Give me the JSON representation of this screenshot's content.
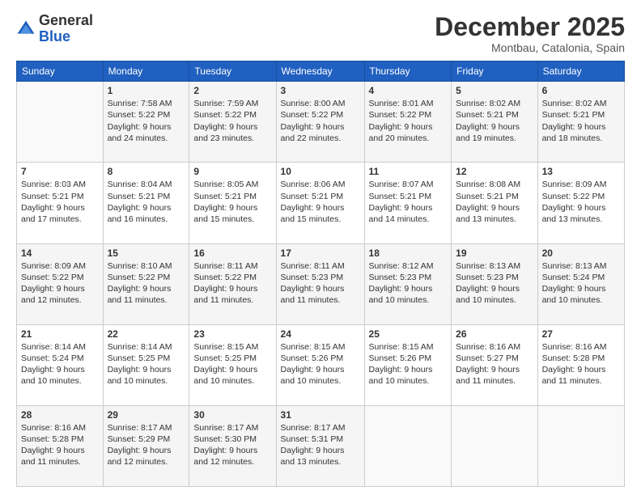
{
  "logo": {
    "general": "General",
    "blue": "Blue"
  },
  "header": {
    "month": "December 2025",
    "location": "Montbau, Catalonia, Spain"
  },
  "weekdays": [
    "Sunday",
    "Monday",
    "Tuesday",
    "Wednesday",
    "Thursday",
    "Friday",
    "Saturday"
  ],
  "weeks": [
    [
      {
        "day": "",
        "info": ""
      },
      {
        "day": "1",
        "info": "Sunrise: 7:58 AM\nSunset: 5:22 PM\nDaylight: 9 hours\nand 24 minutes."
      },
      {
        "day": "2",
        "info": "Sunrise: 7:59 AM\nSunset: 5:22 PM\nDaylight: 9 hours\nand 23 minutes."
      },
      {
        "day": "3",
        "info": "Sunrise: 8:00 AM\nSunset: 5:22 PM\nDaylight: 9 hours\nand 22 minutes."
      },
      {
        "day": "4",
        "info": "Sunrise: 8:01 AM\nSunset: 5:22 PM\nDaylight: 9 hours\nand 20 minutes."
      },
      {
        "day": "5",
        "info": "Sunrise: 8:02 AM\nSunset: 5:21 PM\nDaylight: 9 hours\nand 19 minutes."
      },
      {
        "day": "6",
        "info": "Sunrise: 8:02 AM\nSunset: 5:21 PM\nDaylight: 9 hours\nand 18 minutes."
      }
    ],
    [
      {
        "day": "7",
        "info": "Sunrise: 8:03 AM\nSunset: 5:21 PM\nDaylight: 9 hours\nand 17 minutes."
      },
      {
        "day": "8",
        "info": "Sunrise: 8:04 AM\nSunset: 5:21 PM\nDaylight: 9 hours\nand 16 minutes."
      },
      {
        "day": "9",
        "info": "Sunrise: 8:05 AM\nSunset: 5:21 PM\nDaylight: 9 hours\nand 15 minutes."
      },
      {
        "day": "10",
        "info": "Sunrise: 8:06 AM\nSunset: 5:21 PM\nDaylight: 9 hours\nand 15 minutes."
      },
      {
        "day": "11",
        "info": "Sunrise: 8:07 AM\nSunset: 5:21 PM\nDaylight: 9 hours\nand 14 minutes."
      },
      {
        "day": "12",
        "info": "Sunrise: 8:08 AM\nSunset: 5:21 PM\nDaylight: 9 hours\nand 13 minutes."
      },
      {
        "day": "13",
        "info": "Sunrise: 8:09 AM\nSunset: 5:22 PM\nDaylight: 9 hours\nand 13 minutes."
      }
    ],
    [
      {
        "day": "14",
        "info": "Sunrise: 8:09 AM\nSunset: 5:22 PM\nDaylight: 9 hours\nand 12 minutes."
      },
      {
        "day": "15",
        "info": "Sunrise: 8:10 AM\nSunset: 5:22 PM\nDaylight: 9 hours\nand 11 minutes."
      },
      {
        "day": "16",
        "info": "Sunrise: 8:11 AM\nSunset: 5:22 PM\nDaylight: 9 hours\nand 11 minutes."
      },
      {
        "day": "17",
        "info": "Sunrise: 8:11 AM\nSunset: 5:23 PM\nDaylight: 9 hours\nand 11 minutes."
      },
      {
        "day": "18",
        "info": "Sunrise: 8:12 AM\nSunset: 5:23 PM\nDaylight: 9 hours\nand 10 minutes."
      },
      {
        "day": "19",
        "info": "Sunrise: 8:13 AM\nSunset: 5:23 PM\nDaylight: 9 hours\nand 10 minutes."
      },
      {
        "day": "20",
        "info": "Sunrise: 8:13 AM\nSunset: 5:24 PM\nDaylight: 9 hours\nand 10 minutes."
      }
    ],
    [
      {
        "day": "21",
        "info": "Sunrise: 8:14 AM\nSunset: 5:24 PM\nDaylight: 9 hours\nand 10 minutes."
      },
      {
        "day": "22",
        "info": "Sunrise: 8:14 AM\nSunset: 5:25 PM\nDaylight: 9 hours\nand 10 minutes."
      },
      {
        "day": "23",
        "info": "Sunrise: 8:15 AM\nSunset: 5:25 PM\nDaylight: 9 hours\nand 10 minutes."
      },
      {
        "day": "24",
        "info": "Sunrise: 8:15 AM\nSunset: 5:26 PM\nDaylight: 9 hours\nand 10 minutes."
      },
      {
        "day": "25",
        "info": "Sunrise: 8:15 AM\nSunset: 5:26 PM\nDaylight: 9 hours\nand 10 minutes."
      },
      {
        "day": "26",
        "info": "Sunrise: 8:16 AM\nSunset: 5:27 PM\nDaylight: 9 hours\nand 11 minutes."
      },
      {
        "day": "27",
        "info": "Sunrise: 8:16 AM\nSunset: 5:28 PM\nDaylight: 9 hours\nand 11 minutes."
      }
    ],
    [
      {
        "day": "28",
        "info": "Sunrise: 8:16 AM\nSunset: 5:28 PM\nDaylight: 9 hours\nand 11 minutes."
      },
      {
        "day": "29",
        "info": "Sunrise: 8:17 AM\nSunset: 5:29 PM\nDaylight: 9 hours\nand 12 minutes."
      },
      {
        "day": "30",
        "info": "Sunrise: 8:17 AM\nSunset: 5:30 PM\nDaylight: 9 hours\nand 12 minutes."
      },
      {
        "day": "31",
        "info": "Sunrise: 8:17 AM\nSunset: 5:31 PM\nDaylight: 9 hours\nand 13 minutes."
      },
      {
        "day": "",
        "info": ""
      },
      {
        "day": "",
        "info": ""
      },
      {
        "day": "",
        "info": ""
      }
    ]
  ]
}
